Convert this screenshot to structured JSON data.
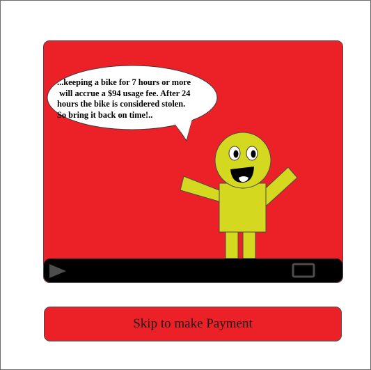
{
  "video": {
    "speech_text": "...keeping a bike for 7 hours or more\n will accrue a $94 usage fee. After 24\nhours the bike is considered stolen.\nSo bring it back on time!..",
    "icons": {
      "play": "play-icon",
      "fullscreen": "fullscreen-icon"
    }
  },
  "skip_button": {
    "label": "Skip to make Payment"
  },
  "colors": {
    "video_background": "#ec2127",
    "character": "#d4d81f",
    "control_bar": "#000000",
    "control_icons": "#4d4d4d"
  }
}
